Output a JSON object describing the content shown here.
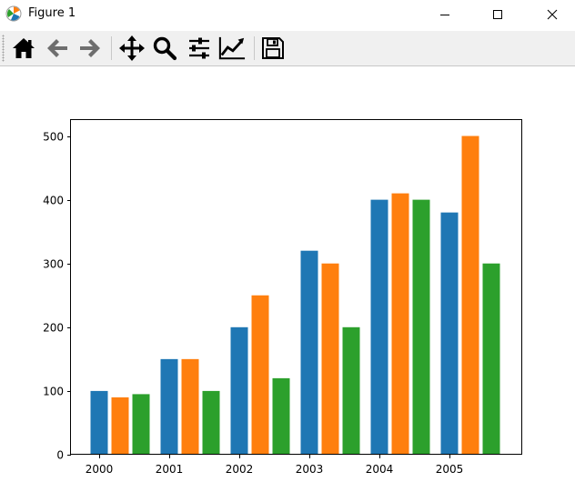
{
  "window": {
    "title": "Figure 1",
    "app_icon": "matplotlib-icon",
    "controls": [
      "minimize-icon",
      "maximize-icon",
      "close-icon"
    ]
  },
  "toolbar": {
    "buttons": [
      {
        "name": "home-icon",
        "label": "Home"
      },
      {
        "name": "back-icon",
        "label": "Back"
      },
      {
        "name": "forward-icon",
        "label": "Forward"
      },
      {
        "name": "pan-icon",
        "label": "Pan"
      },
      {
        "name": "zoom-icon",
        "label": "Zoom"
      },
      {
        "name": "configure-subplots-icon",
        "label": "Subplots"
      },
      {
        "name": "edit-axis-icon",
        "label": "Customize"
      },
      {
        "name": "save-icon",
        "label": "Save"
      }
    ]
  },
  "chart_data": {
    "type": "bar",
    "categories": [
      "2000",
      "2001",
      "2002",
      "2003",
      "2004",
      "2005"
    ],
    "series": [
      {
        "color": "#1f77b4",
        "values": [
          100,
          150,
          200,
          320,
          400,
          380
        ]
      },
      {
        "color": "#ff7f0e",
        "values": [
          90,
          150,
          250,
          300,
          410,
          500
        ]
      },
      {
        "color": "#2ca02c",
        "values": [
          95,
          100,
          120,
          200,
          400,
          300
        ]
      }
    ],
    "yticks": [
      0,
      100,
      200,
      300,
      400,
      500
    ],
    "ylim": [
      0,
      525
    ],
    "title": "",
    "xlabel": "",
    "ylabel": "",
    "grid": false,
    "legend": false
  }
}
